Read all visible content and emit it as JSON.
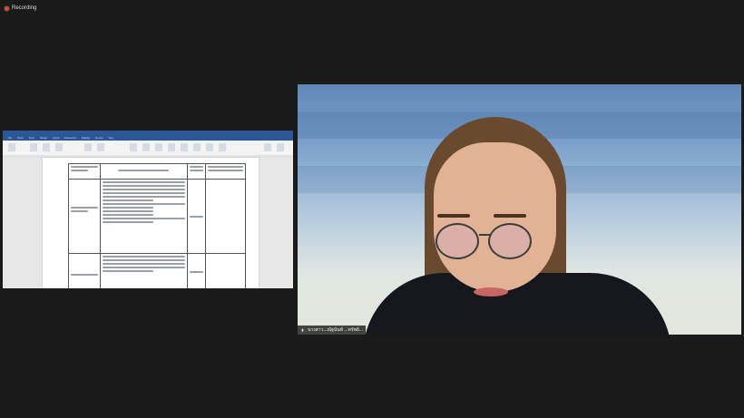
{
  "recording": {
    "label": "Recording",
    "color": "#e0483e"
  },
  "share": {
    "app": "Microsoft Word",
    "tabs": [
      "File",
      "Home",
      "Insert",
      "Design",
      "Layout",
      "References",
      "Mailings",
      "Review",
      "View"
    ]
  },
  "participant": {
    "name": "นางสาว...ณัฐนันท์ ...ทรัพย์...",
    "mic_icon": "mic-icon"
  }
}
